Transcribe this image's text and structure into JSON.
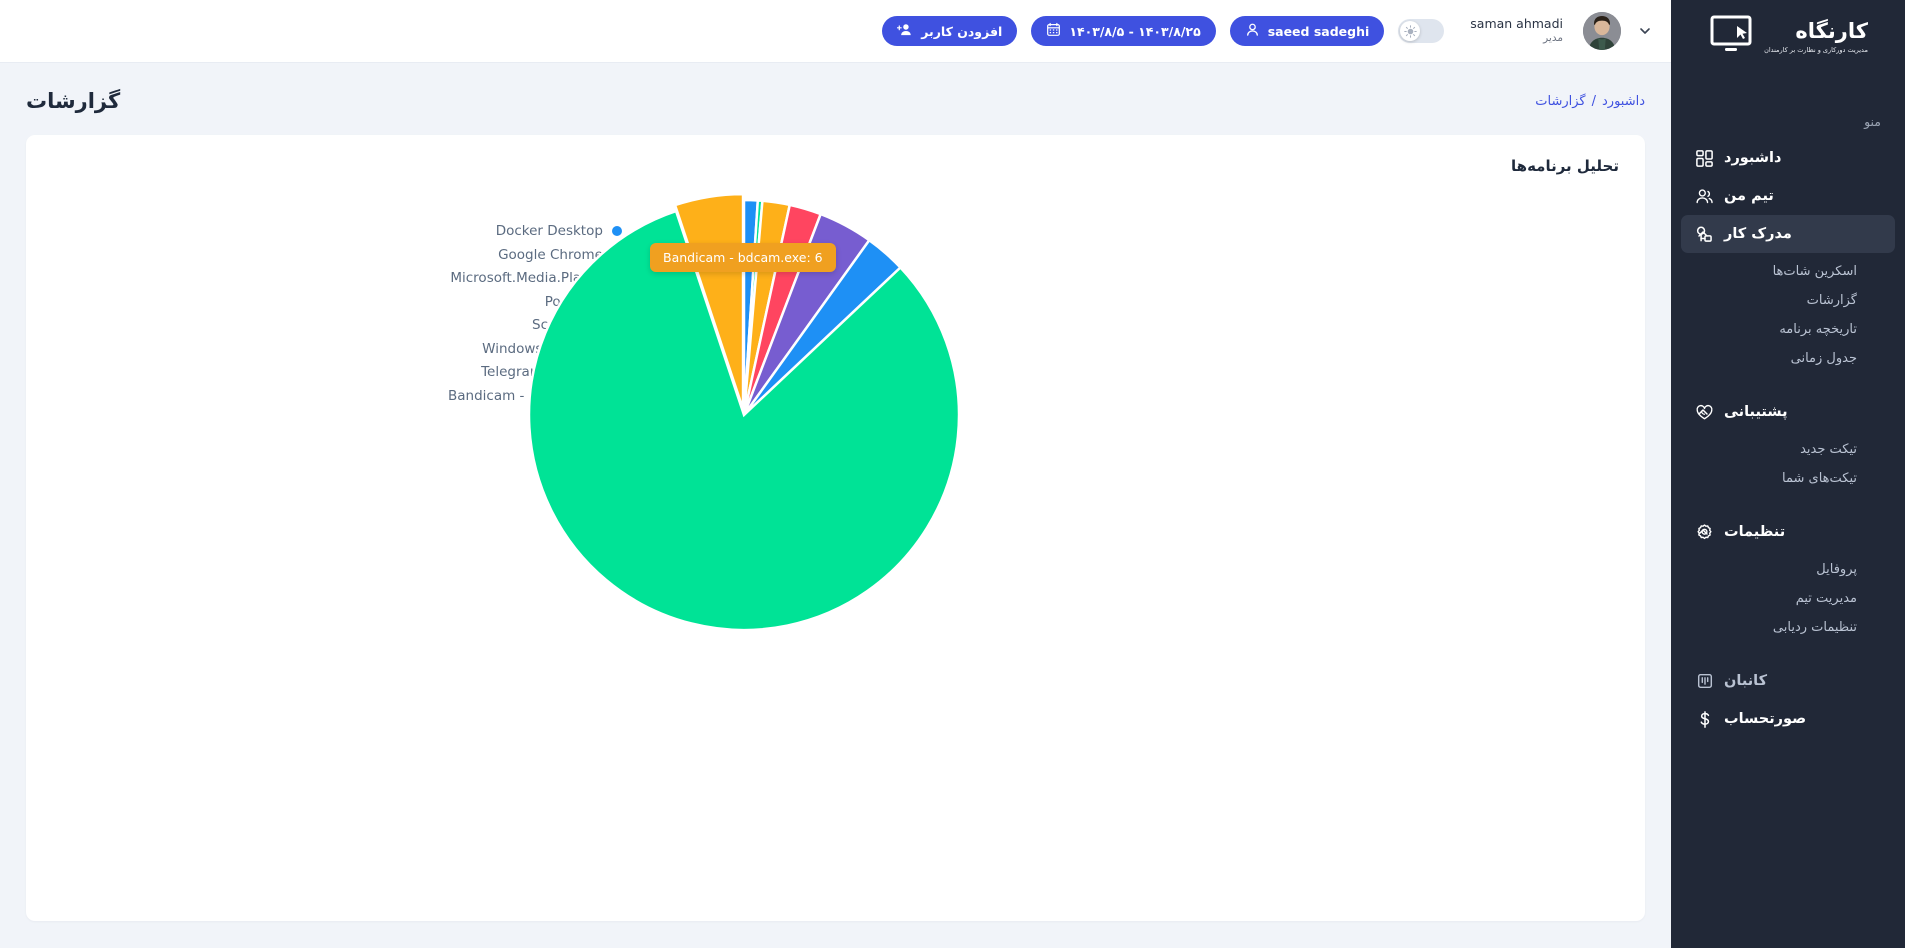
{
  "brand": {
    "title": "کارنگاه",
    "subtitle": "مدیریت دورکاری و نظارت بر کارمندان",
    "logo_icon": "monitor-cursor-icon"
  },
  "sidebar": {
    "menu_label": "منو",
    "items": [
      {
        "label": "داشبورد",
        "icon": "grid-icon",
        "active": false,
        "expandable": false,
        "children": []
      },
      {
        "label": "تیم من",
        "icon": "users-icon",
        "active": false,
        "expandable": false,
        "children": []
      },
      {
        "label": "مدرک کار",
        "icon": "work-node-icon",
        "active": true,
        "expandable": true,
        "children": [
          "اسکرین شات‌ها",
          "گزارشات",
          "تاریخچه برنامه",
          "جدول زمانی"
        ]
      },
      {
        "label": "پشتیبانی",
        "icon": "heart-chat-icon",
        "active": false,
        "expandable": true,
        "children": [
          "تیکت جدید",
          "تیکت‌های شما"
        ]
      },
      {
        "label": "تنظیمات",
        "icon": "gear-icon",
        "active": false,
        "expandable": true,
        "children": [
          "پروفایل",
          "مدیریت تیم",
          "تنظیمات ردیابی"
        ]
      },
      {
        "label": "کانبان",
        "icon": "kanban-icon",
        "active": false,
        "expandable": false,
        "children": []
      },
      {
        "label": "صورتحساب",
        "icon": "dollar-icon",
        "active": false,
        "expandable": false,
        "children": []
      }
    ]
  },
  "topbar": {
    "user_name": "saman ahmadi",
    "user_role": "مدیر",
    "avatar_alt": "saman ahmadi",
    "theme_toggle_state": "light",
    "selected_user_button": "saeed sadeghi",
    "date_range_button": "۱۴۰۳/۸/۲۵ - ۱۴۰۳/۸/۵",
    "add_user_button": "افزودن کاربر"
  },
  "page": {
    "title": "گزارشات",
    "breadcrumb": [
      "داشبورد",
      "گزارشات"
    ],
    "breadcrumb_separator": "/"
  },
  "card": {
    "title": "تحلیل برنامه‌ها"
  },
  "tooltip": {
    "text": "Bandicam - bdcam.exe: 6",
    "bg_color": "#f0a020"
  },
  "colors": {
    "accent": "#3f51e0",
    "sidebar_bg": "#212837",
    "sidebar_active": "#323a4b",
    "page_bg": "#f1f4f9",
    "card_bg": "#ffffff",
    "title": "#1f2a3c",
    "muted": "#5b6b80"
  },
  "chart_data": {
    "type": "pie",
    "title": "تحلیل برنامه‌ها",
    "legend_position": "left",
    "categories": [
      "Docker Desktop",
      "Google Chrome",
      "Microsoft.Media.Player",
      "Postman",
      "ScreenRec",
      "Windows Explorer",
      "Telegram Desktop",
      "Bandicam - bdcam.exe"
    ],
    "values": [
      3,
      1,
      6,
      7,
      12,
      9,
      240,
      15
    ],
    "colors": [
      "#1e90f5",
      "#00e396",
      "#feb019",
      "#ff4560",
      "#775dd0",
      "#1e90f5",
      "#00e396",
      "#feb019"
    ],
    "highlighted": "Bandicam - bdcam.exe",
    "highlighted_value": 6
  }
}
